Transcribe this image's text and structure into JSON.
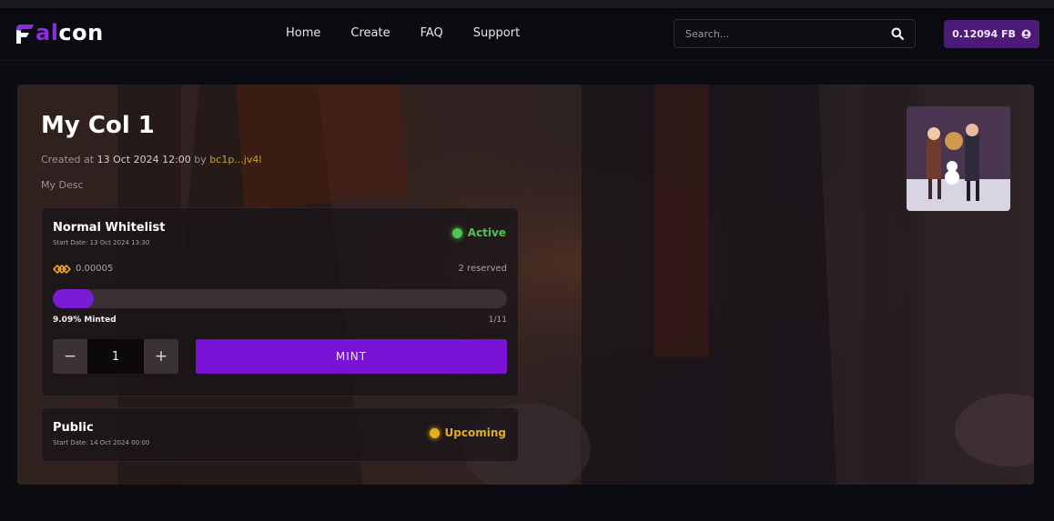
{
  "brand": {
    "logo_letters_accent": "al",
    "logo_letters_rest": "con",
    "accent_color": "#8b2ce0"
  },
  "nav": {
    "items": [
      "Home",
      "Create",
      "FAQ",
      "Support"
    ]
  },
  "search": {
    "placeholder": "Search..."
  },
  "wallet": {
    "balance": "0.12094 FB"
  },
  "collection": {
    "title": "My Col 1",
    "created_prefix": "Created at",
    "created_date": "13 Oct 2024 12:00",
    "created_by": "by",
    "creator_address": "bc1p...jv4l",
    "description": "My Desc"
  },
  "phases": [
    {
      "name": "Normal Whitelist",
      "start_date": "Start Date: 13 Oct 2024 13:30",
      "status": "Active",
      "status_color": "#4ec54a",
      "price": "0.00005",
      "reserved": "2 reserved",
      "progress_fraction": 0.0909,
      "minted_label": "9.09% Minted",
      "minted_count": "1/11",
      "quantity": "1",
      "decrement": "−",
      "increment": "+",
      "mint_label": "MINT"
    },
    {
      "name": "Public",
      "start_date": "Start Date: 14 Oct 2024 00:00",
      "status": "Upcoming",
      "status_color": "#e4ae1c"
    }
  ]
}
